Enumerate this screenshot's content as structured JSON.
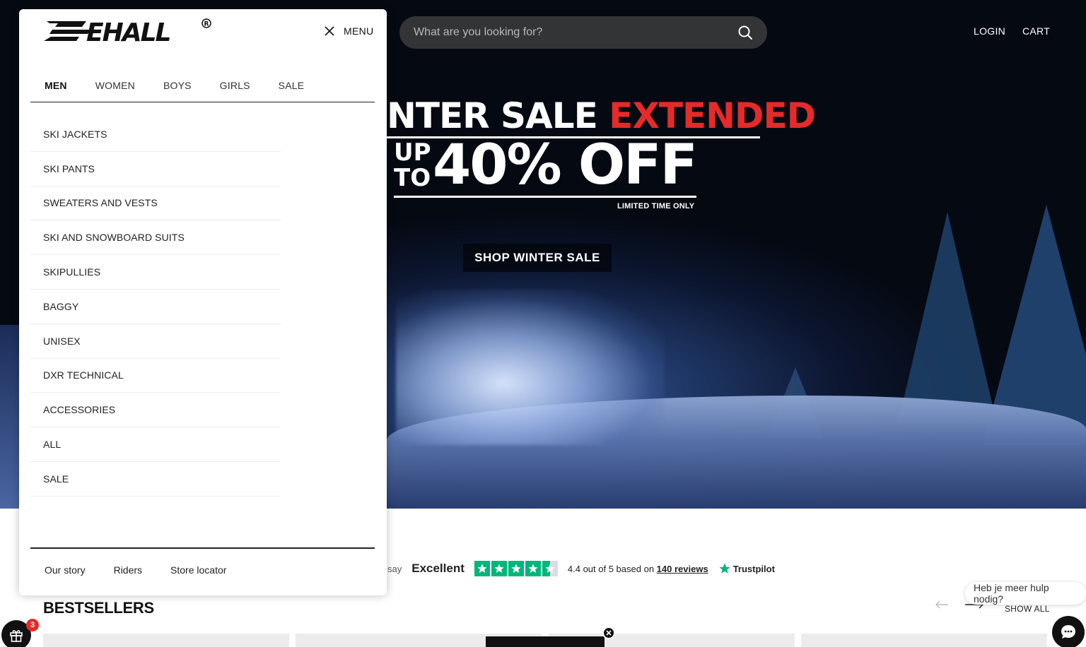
{
  "header": {
    "search_placeholder": "What are you looking for?",
    "login": "LOGIN",
    "cart": "CART"
  },
  "hero": {
    "headline_white": "NTER SALE",
    "headline_red": "EXTENDED",
    "up": "UP",
    "to": "TO",
    "discount": "40% OFF",
    "limited": "LIMITED TIME ONLY",
    "cta": "SHOP WINTER SALE"
  },
  "drawer": {
    "menu_label": "MENU",
    "tabs": [
      "MEN",
      "WOMEN",
      "BOYS",
      "GIRLS",
      "SALE"
    ],
    "categories": [
      "SKI JACKETS",
      "SKI PANTS",
      "SWEATERS AND VESTS",
      "SKI AND SNOWBOARD SUITS",
      "SKIPULLIES",
      "BAGGY",
      "UNISEX",
      "DXR TECHNICAL",
      "ACCESSORIES",
      "ALL",
      "SALE"
    ],
    "footer_links": [
      "Our story",
      "Riders",
      "Store locator"
    ]
  },
  "trustpilot": {
    "say": "say",
    "rating_word": "Excellent",
    "score_prefix": "4.4 out of 5 based on",
    "reviews_link": "140 reviews",
    "brand": "Trustpilot",
    "star_color": "#00b67a"
  },
  "bestsellers": {
    "title": "BESTSELLERS",
    "show_all": "SHOW ALL"
  },
  "chat": {
    "help_text": "Heb je meer hulp nodig?"
  },
  "rewards": {
    "badge_count": "3"
  },
  "colors": {
    "accent_red": "#e52a2a"
  }
}
